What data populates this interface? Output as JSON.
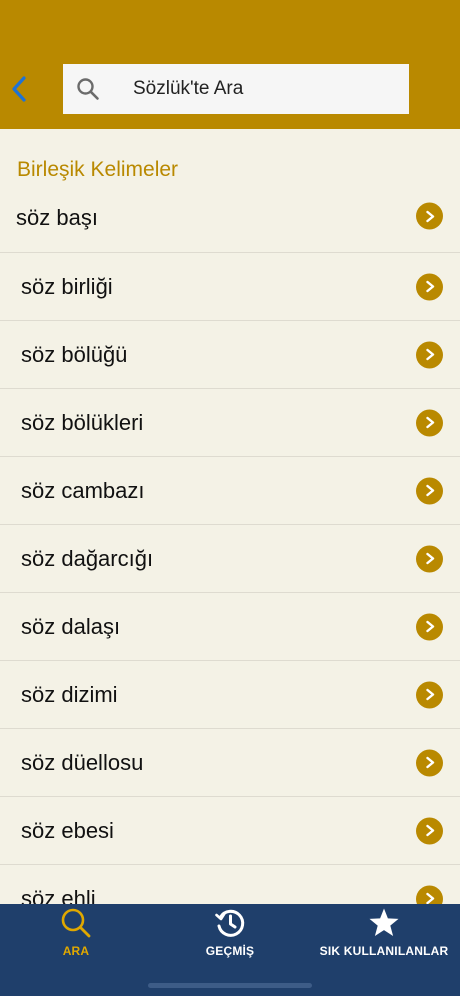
{
  "colors": {
    "brand": "#b98900",
    "background": "#f4f2e6",
    "tabbar": "#1f3f6b",
    "tab_active": "#e0a800",
    "back_arrow": "#1e73d6"
  },
  "header": {
    "back_icon": "chevron-left-icon",
    "search": {
      "icon": "search-icon",
      "placeholder": "Sözlük'te Ara"
    }
  },
  "section": {
    "title": "Birleşik Kelimeler"
  },
  "items": [
    {
      "label": "söz başı"
    },
    {
      "label": "söz birliği"
    },
    {
      "label": "söz bölüğü"
    },
    {
      "label": "söz bölükleri"
    },
    {
      "label": "söz cambazı"
    },
    {
      "label": "söz dağarcığı"
    },
    {
      "label": "söz dalaşı"
    },
    {
      "label": "söz dizimi"
    },
    {
      "label": "söz düellosu"
    },
    {
      "label": "söz ebesi"
    },
    {
      "label": "söz ehli"
    }
  ],
  "tabbar": {
    "tabs": [
      {
        "label": "ARA",
        "icon": "search-icon",
        "active": true
      },
      {
        "label": "GEÇMİŞ",
        "icon": "history-icon",
        "active": false
      },
      {
        "label": "SIK KULLANILANLAR",
        "icon": "star-icon",
        "active": false
      }
    ]
  }
}
